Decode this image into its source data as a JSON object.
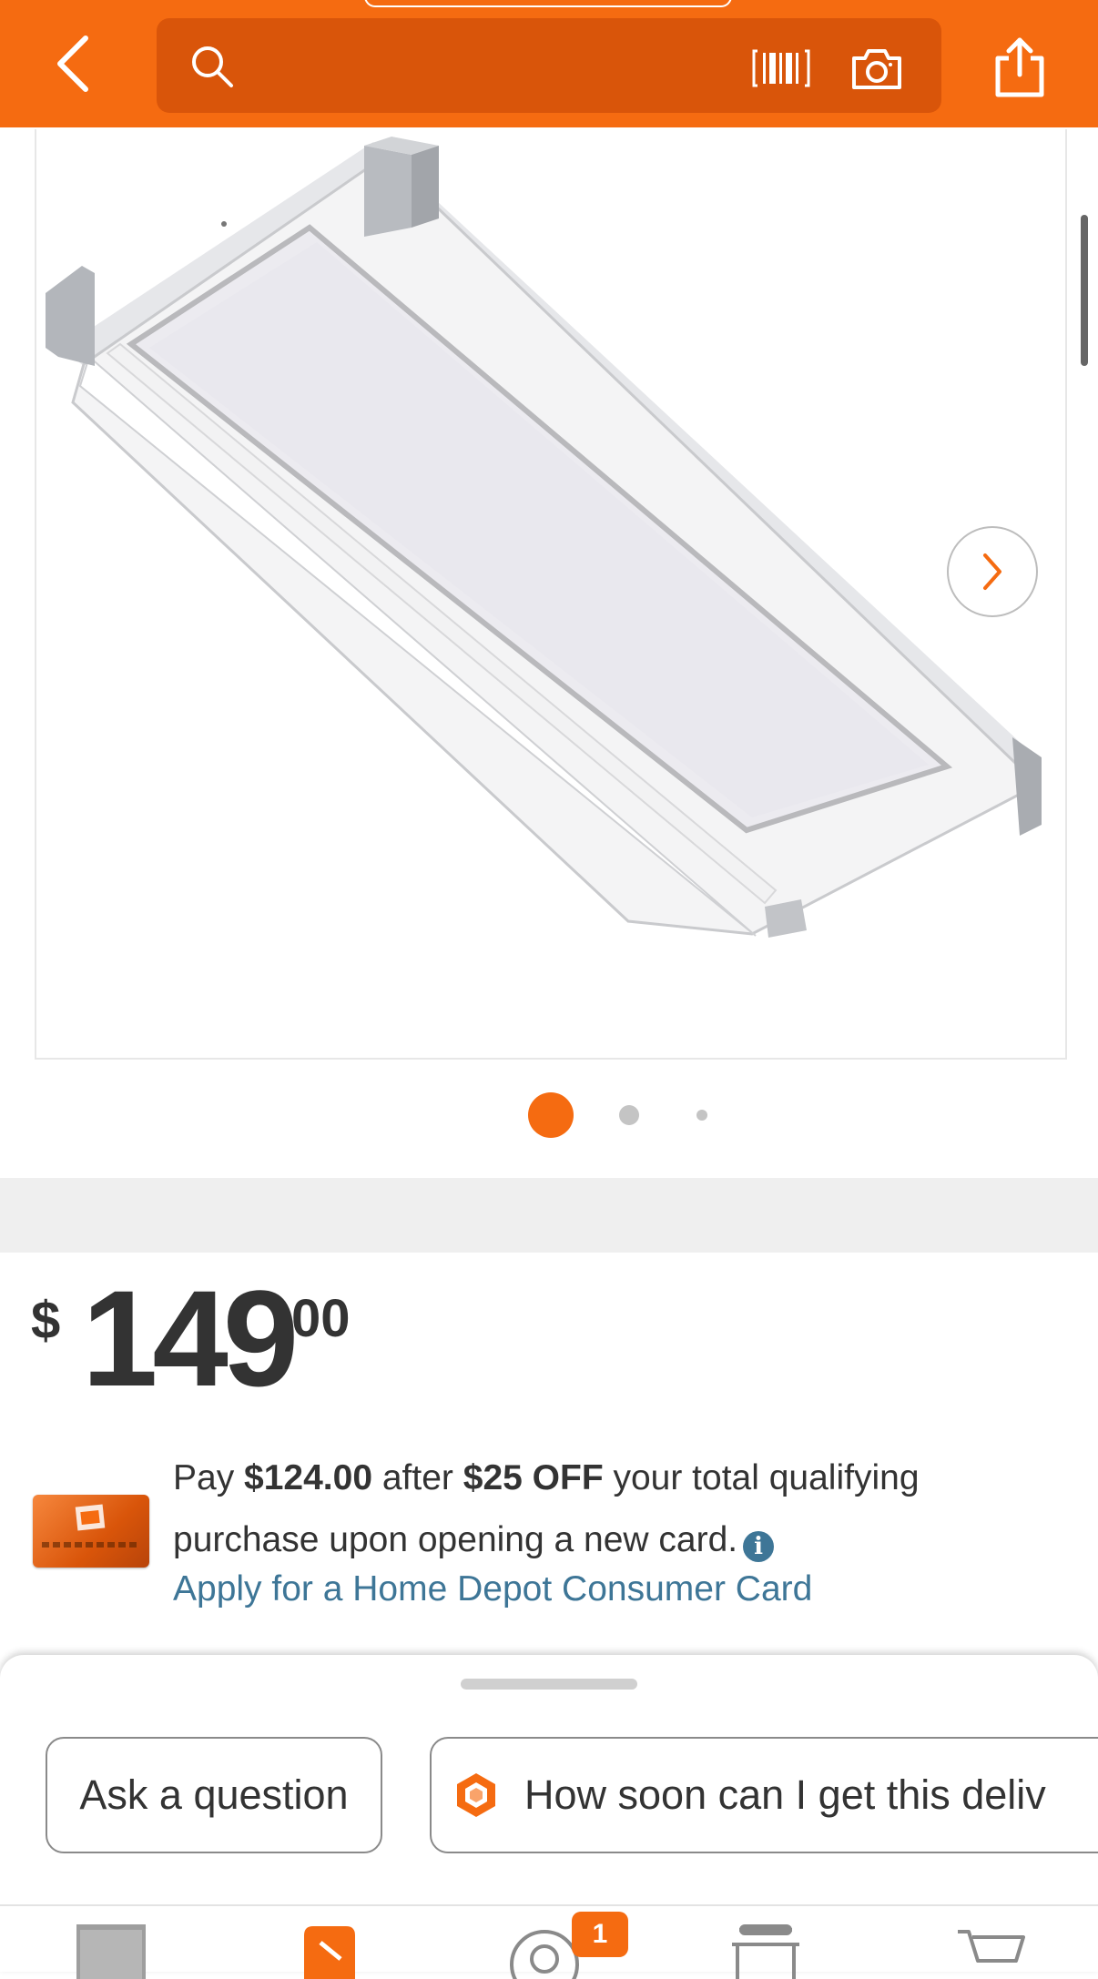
{
  "header": {
    "search_placeholder": "",
    "icons": [
      "back-icon",
      "search-icon",
      "barcode-icon",
      "camera-icon",
      "share-icon"
    ],
    "brand_color": "#f56b11"
  },
  "gallery": {
    "image_count": 3,
    "active_index": 0,
    "image_subject": "product-image"
  },
  "price": {
    "currency": "$",
    "dollars": "149",
    "cents": "00"
  },
  "promo": {
    "text_1": "Pay ",
    "discounted_price": "$124.00",
    "text_2": " after ",
    "discount": "$25 OFF",
    "text_3": " your total qualifying purchase upon opening a new card.",
    "link": "Apply for a Home Depot Consumer Card",
    "link_color": "#3e7697"
  },
  "assistant_sheet": {
    "chips": [
      {
        "label": "Ask a question"
      },
      {
        "label": "How soon can I get this deliv"
      }
    ]
  },
  "bottom_nav": {
    "items": [
      "home-logo-icon",
      "lists-icon",
      "me-icon",
      "store-icon",
      "cart-icon"
    ],
    "me_badge": "1"
  }
}
